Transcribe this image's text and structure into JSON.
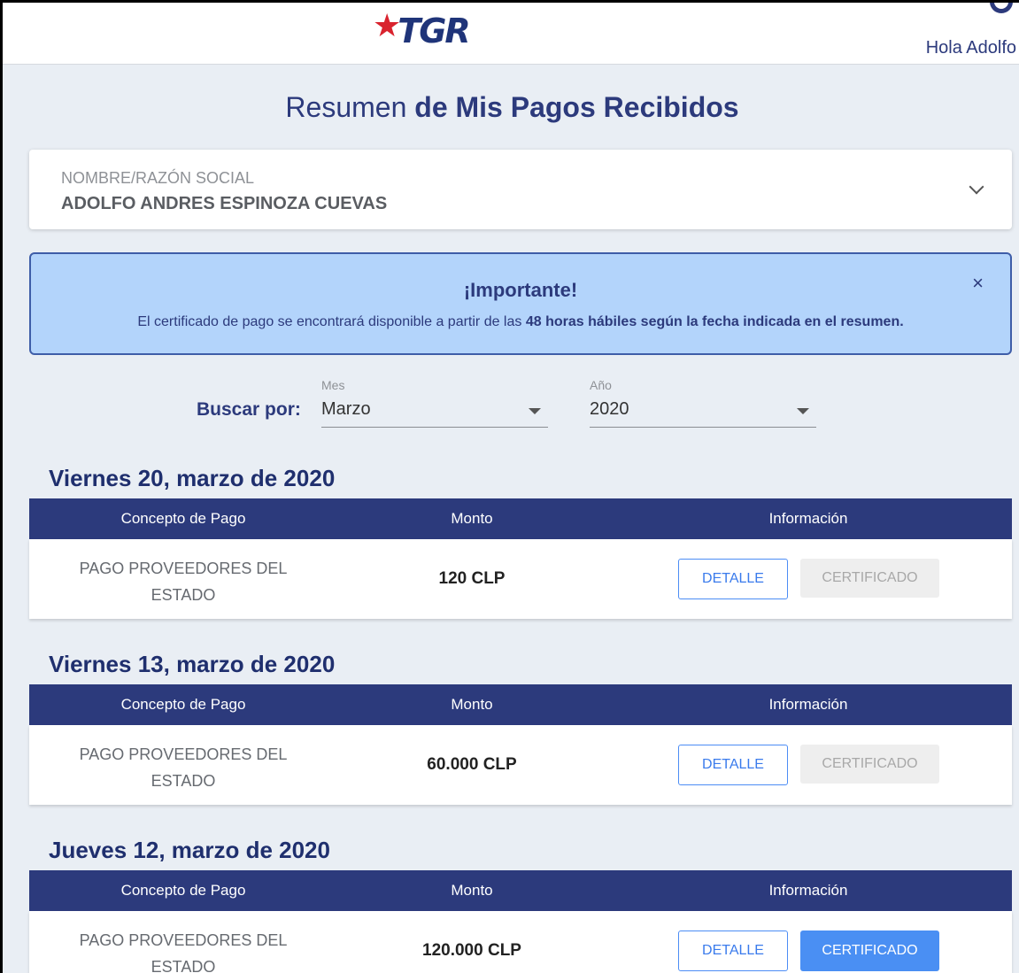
{
  "header": {
    "logo_text": "TGR",
    "greeting": "Hola Adolfo"
  },
  "title": {
    "light": "Resumen",
    "bold": "de Mis Pagos Recibidos"
  },
  "name_card": {
    "label": "NOMBRE/RAZÓN SOCIAL",
    "value": "ADOLFO ANDRES ESPINOZA CUEVAS"
  },
  "alert": {
    "title": "¡Importante!",
    "text_before": "El certificado de pago se encontrará disponible a partir de las ",
    "text_bold": "48 horas hábiles según la fecha indicada en el resumen.",
    "close": "×"
  },
  "filter": {
    "label": "Buscar por:",
    "mes_label": "Mes",
    "mes_value": "Marzo",
    "anio_label": "Año",
    "anio_value": "2020"
  },
  "table_headers": {
    "concept": "Concepto de Pago",
    "monto": "Monto",
    "info": "Información"
  },
  "groups": [
    {
      "date": "Viernes 20, marzo de 2020",
      "concept_line1": "PAGO PROVEEDORES DEL",
      "concept_line2": "ESTADO",
      "monto": "120 CLP",
      "detalle": "DETALLE",
      "certificado": "CERTIFICADO",
      "cert_enabled": false
    },
    {
      "date": "Viernes 13, marzo de 2020",
      "concept_line1": "PAGO PROVEEDORES DEL",
      "concept_line2": "ESTADO",
      "monto": "60.000 CLP",
      "detalle": "DETALLE",
      "certificado": "CERTIFICADO",
      "cert_enabled": false
    },
    {
      "date": "Jueves 12, marzo de 2020",
      "concept_line1": "PAGO PROVEEDORES DEL",
      "concept_line2": "ESTADO",
      "monto": "120.000 CLP",
      "detalle": "DETALLE",
      "certificado": "CERTIFICADO",
      "cert_enabled": true
    }
  ],
  "colors": {
    "primary": "#2c3a7c",
    "accent": "#4a8ff3",
    "alert_bg": "#b3d4fb",
    "logo_star": "#d9232e"
  }
}
